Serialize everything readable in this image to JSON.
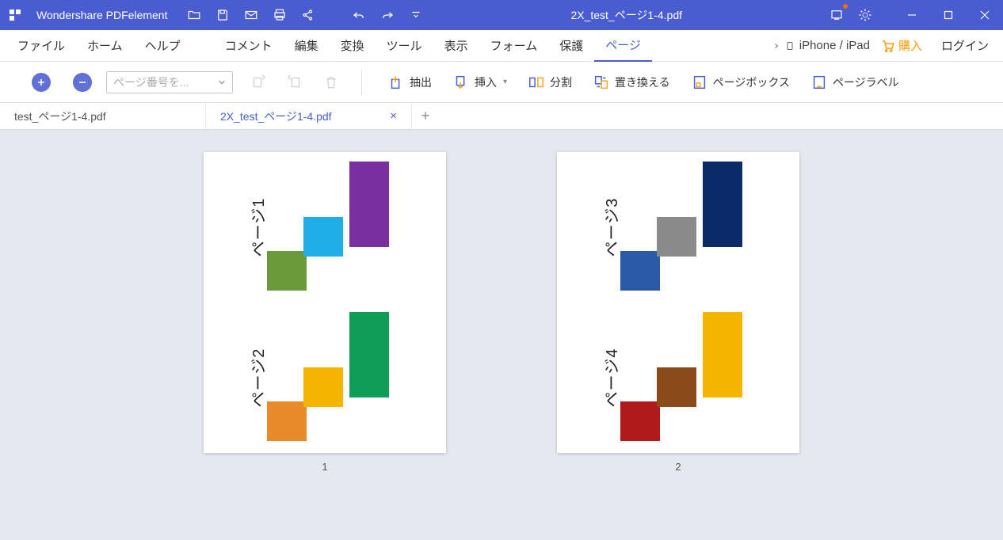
{
  "app": {
    "name": "Wondershare PDFelement",
    "doc_title": "2X_test_ページ1-4.pdf"
  },
  "menu": {
    "file": "ファイル",
    "home": "ホーム",
    "help": "ヘルプ",
    "comment": "コメント",
    "edit": "編集",
    "convert": "変換",
    "tool": "ツール",
    "view": "表示",
    "form": "フォーム",
    "protect": "保護",
    "page": "ページ",
    "device": "iPhone / iPad",
    "buy": "購入",
    "login": "ログイン"
  },
  "toolbar": {
    "page_select_placeholder": "ページ番号を...",
    "extract": "抽出",
    "insert": "挿入",
    "split": "分割",
    "replace": "置き換える",
    "page_box": "ページボックス",
    "page_label": "ページラベル"
  },
  "tabs": {
    "inactive": "test_ページ1-4.pdf",
    "active": "2X_test_ページ1-4.pdf"
  },
  "pages": {
    "p1": {
      "num": "1",
      "labelA": "ページ1",
      "labelB": "ページ2"
    },
    "p2": {
      "num": "2",
      "labelA": "ページ3",
      "labelB": "ページ4"
    }
  },
  "colors": {
    "p1a": {
      "c1": "#6a9a3a",
      "c2": "#1eaee8",
      "c3": "#7a2fa0"
    },
    "p1b": {
      "c1": "#e88a2a",
      "c2": "#f5b400",
      "c3": "#0f9d58"
    },
    "p2a": {
      "c1": "#2a5aa8",
      "c2": "#8a8a8a",
      "c3": "#0a2a6a"
    },
    "p2b": {
      "c1": "#b01a1a",
      "c2": "#8a4a1a",
      "c3": "#f5b400"
    }
  }
}
